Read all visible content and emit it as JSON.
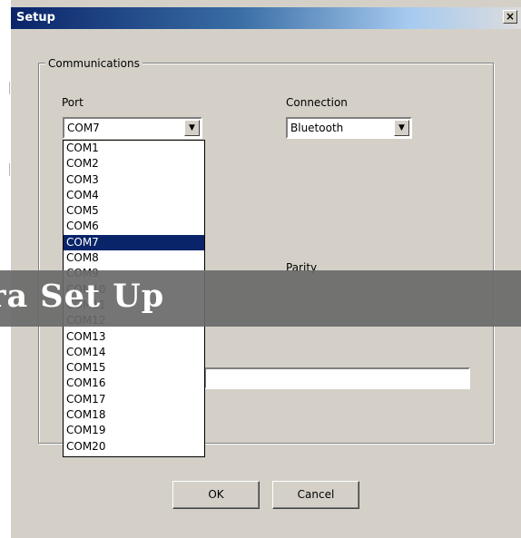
{
  "window": {
    "title": "Setup",
    "close_glyph": "×"
  },
  "group": {
    "label": "Communications"
  },
  "port": {
    "label": "Port",
    "value": "COM7",
    "options": [
      "COM1",
      "COM2",
      "COM3",
      "COM4",
      "COM5",
      "COM6",
      "COM7",
      "COM8",
      "COM9",
      "COM10",
      "COM11",
      "COM12",
      "COM13",
      "COM14",
      "COM15",
      "COM16",
      "COM17",
      "COM18",
      "COM19",
      "COM20"
    ],
    "selected_index": 6
  },
  "connection": {
    "label": "Connection",
    "value": "Bluetooth"
  },
  "parity": {
    "label": "Parity"
  },
  "buttons": {
    "ok": "OK",
    "cancel": "Cancel"
  },
  "overlay": {
    "text": "ra Set Up"
  },
  "colors": {
    "selection": "#0a246a",
    "dialog_bg": "#d4d0c8",
    "banner_bg": "#696969"
  }
}
